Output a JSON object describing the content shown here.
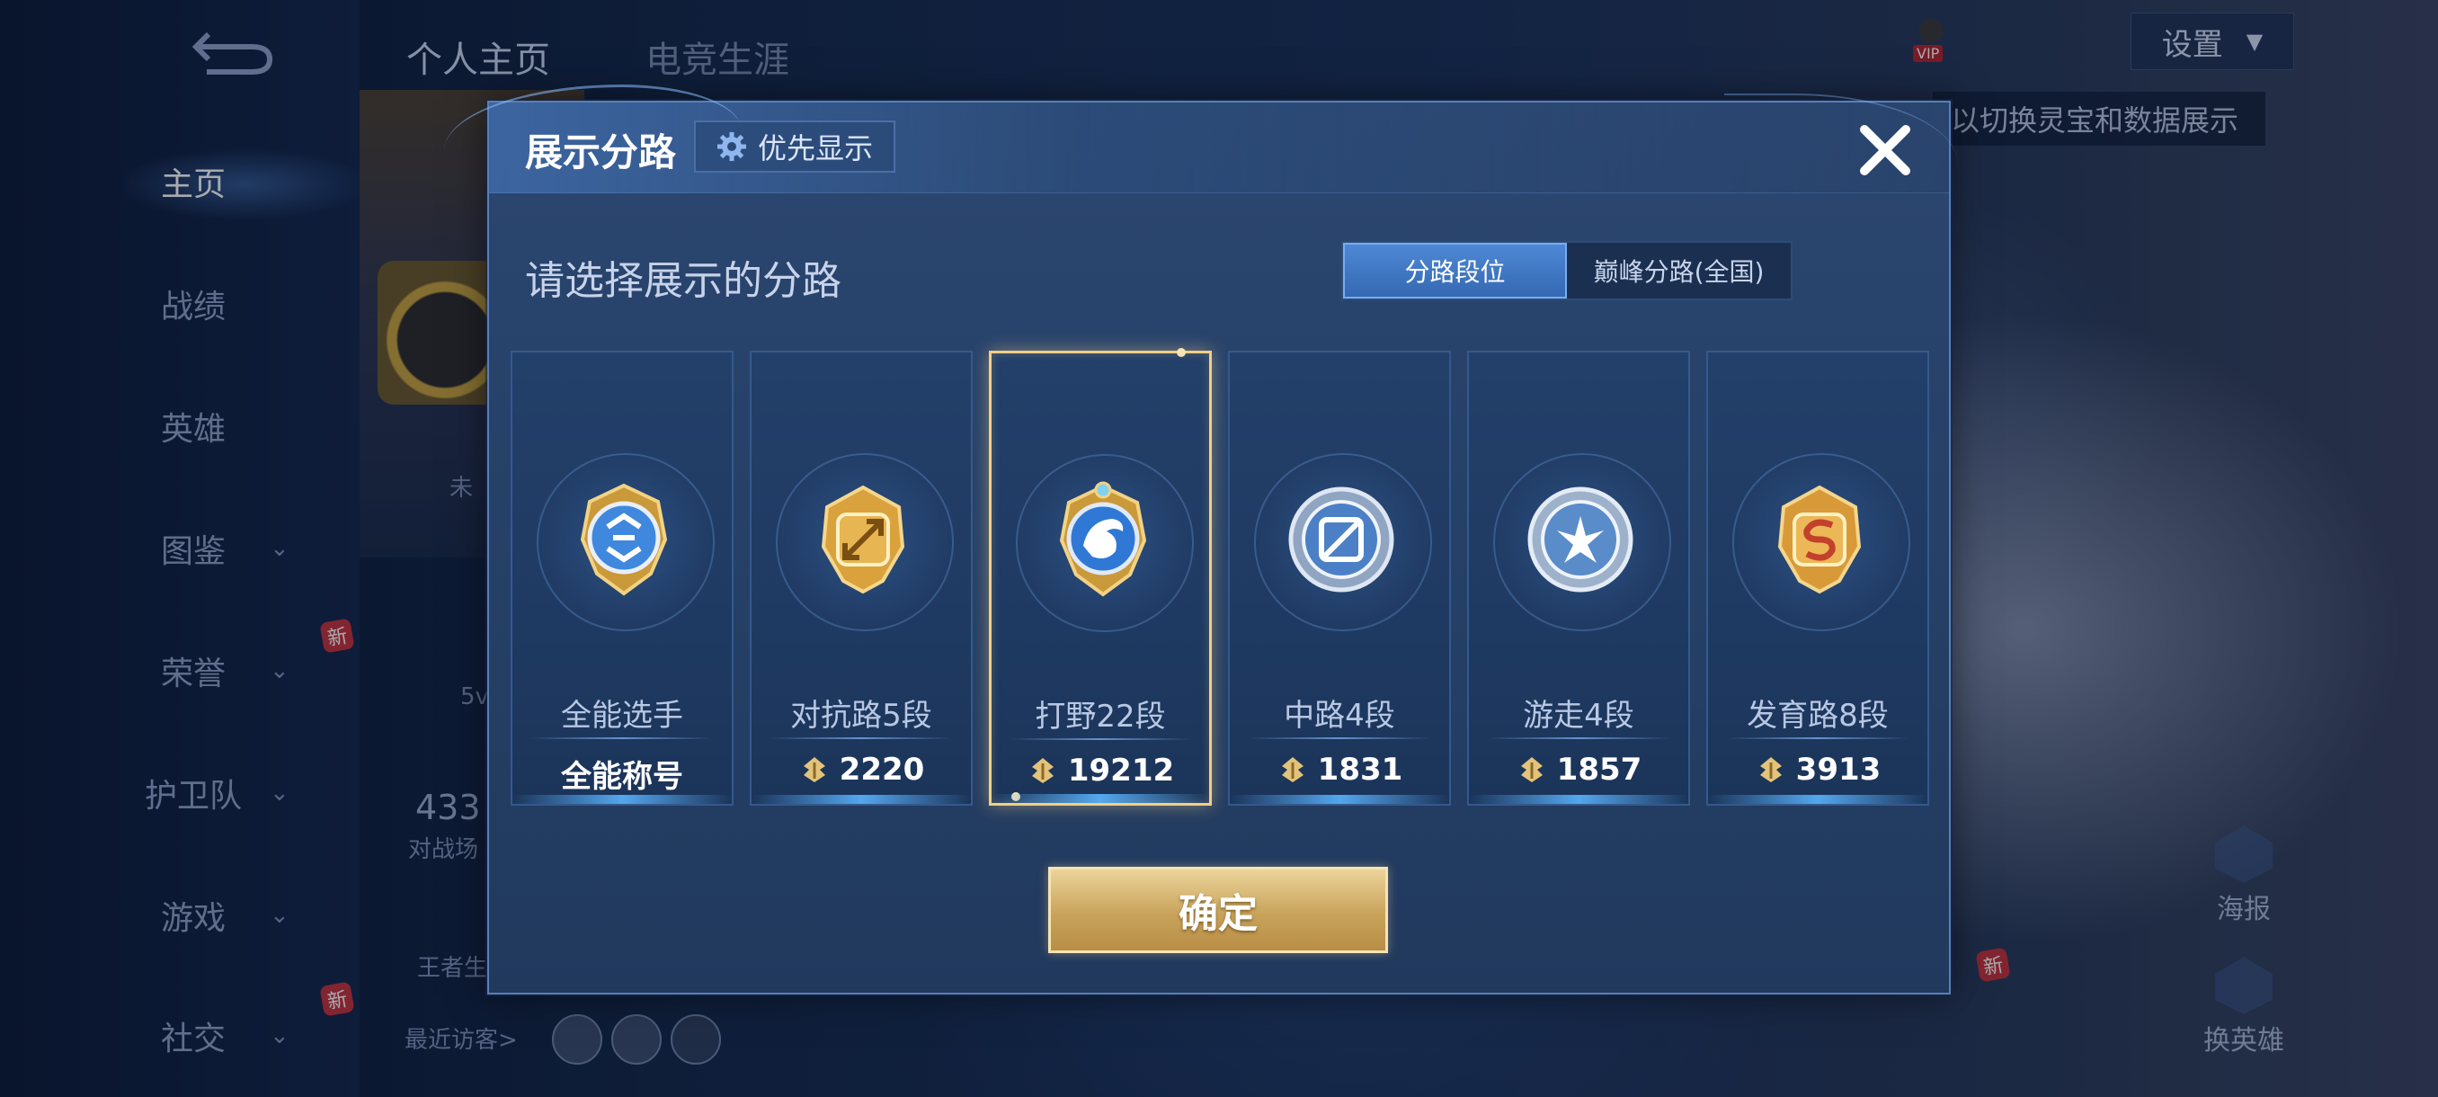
{
  "background": {
    "tabs": [
      "个人主页",
      "电竞生涯"
    ],
    "nav_items": [
      {
        "label": "主页",
        "active": true,
        "has_chevron": false,
        "new": false
      },
      {
        "label": "战绩",
        "active": false,
        "has_chevron": false,
        "new": false
      },
      {
        "label": "英雄",
        "active": false,
        "has_chevron": false,
        "new": false
      },
      {
        "label": "图鉴",
        "active": false,
        "has_chevron": true,
        "new": false
      },
      {
        "label": "荣誉",
        "active": false,
        "has_chevron": true,
        "new": true
      },
      {
        "label": "护卫队",
        "active": false,
        "has_chevron": true,
        "new": false
      },
      {
        "label": "游戏",
        "active": false,
        "has_chevron": true,
        "new": false
      },
      {
        "label": "社交",
        "active": false,
        "has_chevron": true,
        "new": true
      }
    ],
    "new_badge": "新",
    "settings_label": "设置",
    "vip_label": "VIP",
    "hint_text": "以切换灵宝和数据展示",
    "recent_visitors_label": "最近访客>",
    "stat_value": "433",
    "stat_label": "对战场",
    "mode_label": "5v",
    "status_prefix": "未",
    "king_label": "王者生",
    "poster_label": "海报",
    "swap_hero_label": "换英雄"
  },
  "modal": {
    "title": "展示分路",
    "priority_label": "优先显示",
    "subtitle": "请选择展示的分路",
    "toggle": {
      "options": [
        "分路段位",
        "巅峰分路(全国)"
      ],
      "selected_index": 0
    },
    "lanes": [
      {
        "name": "全能选手",
        "value": "全能称号",
        "show_icon": false,
        "emblem": "allround-emblem",
        "color": "#4b8ee0",
        "selected": false
      },
      {
        "name": "对抗路5段",
        "value": "2220",
        "show_icon": true,
        "emblem": "clash-lane-emblem",
        "color": "#d9a23c",
        "selected": false
      },
      {
        "name": "打野22段",
        "value": "19212",
        "show_icon": true,
        "emblem": "jungle-emblem",
        "color": "#2f78d6",
        "selected": true
      },
      {
        "name": "中路4段",
        "value": "1831",
        "show_icon": true,
        "emblem": "mid-lane-emblem",
        "color": "#9fb3cc",
        "selected": false
      },
      {
        "name": "游走4段",
        "value": "1857",
        "show_icon": true,
        "emblem": "roam-emblem",
        "color": "#a9bdd6",
        "selected": false
      },
      {
        "name": "发育路8段",
        "value": "3913",
        "show_icon": true,
        "emblem": "farm-lane-emblem",
        "color": "#d89a38",
        "selected": false
      }
    ],
    "confirm_label": "确定"
  },
  "colors": {
    "accent_gold": "#f1cf86",
    "panel_blue": "#264168",
    "toggle_active": "#3f7bc8"
  }
}
